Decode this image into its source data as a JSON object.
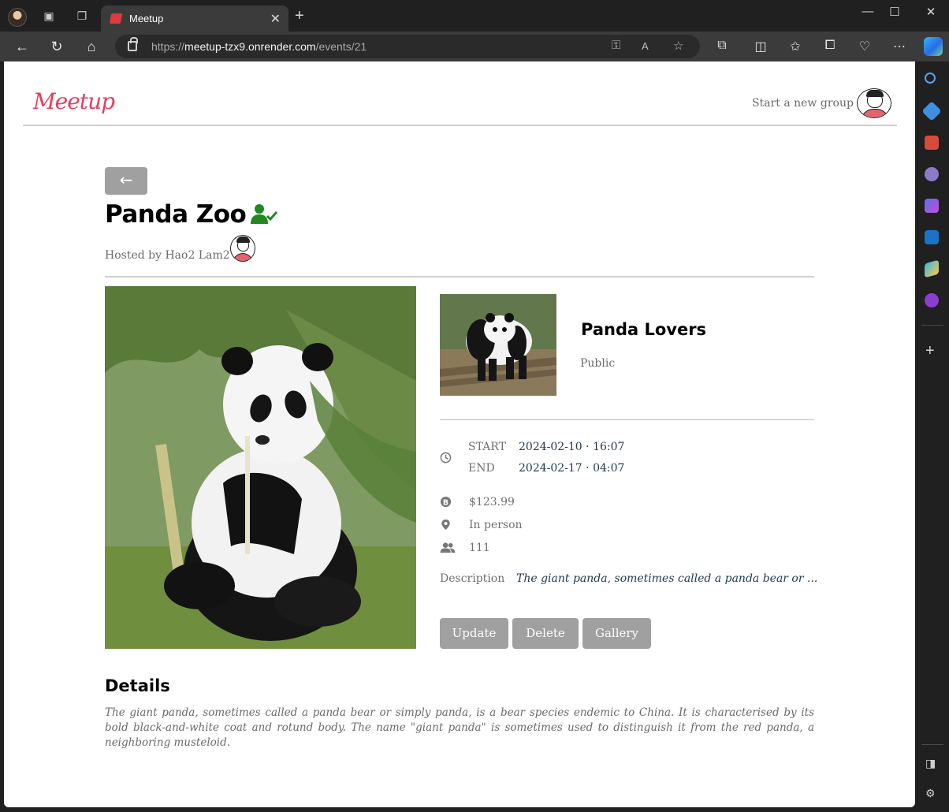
{
  "browser": {
    "tab_title": "Meetup",
    "url_prefix": "https://",
    "url_host": "meetup-tzx9.onrender.com",
    "url_path": "/events/21"
  },
  "header": {
    "logo_text": "Meetup",
    "start_group_label": "Start a new group"
  },
  "event": {
    "back_label": "←",
    "title": "Panda Zoo",
    "hosted_by": "Hosted by Hao2 Lam2",
    "start_label": "START",
    "start_value": "2024-02-10 · 16:07",
    "end_label": "END",
    "end_value": "2024-02-17 · 04:07",
    "price": "$123.99",
    "type": "In person",
    "attendees": "111",
    "description_label": "Description",
    "description_short": "The giant panda, sometimes called a panda bear or ..."
  },
  "group": {
    "name": "Panda Lovers",
    "privacy": "Public"
  },
  "actions": {
    "update_label": "Update",
    "delete_label": "Delete",
    "gallery_label": "Gallery"
  },
  "details": {
    "heading": "Details",
    "text": "The giant panda, sometimes called a panda bear or simply panda, is a bear species endemic to China. It is characterised by its bold black-and-white coat and rotund body. The name \"giant panda\" is sometimes used to distinguish it from the red panda, a neighboring musteloid."
  },
  "colors": {
    "brand": "#e0415e",
    "button": "#a0a0a0",
    "joined_icon": "#1f8a1f",
    "value_text": "#1f3a4d"
  }
}
